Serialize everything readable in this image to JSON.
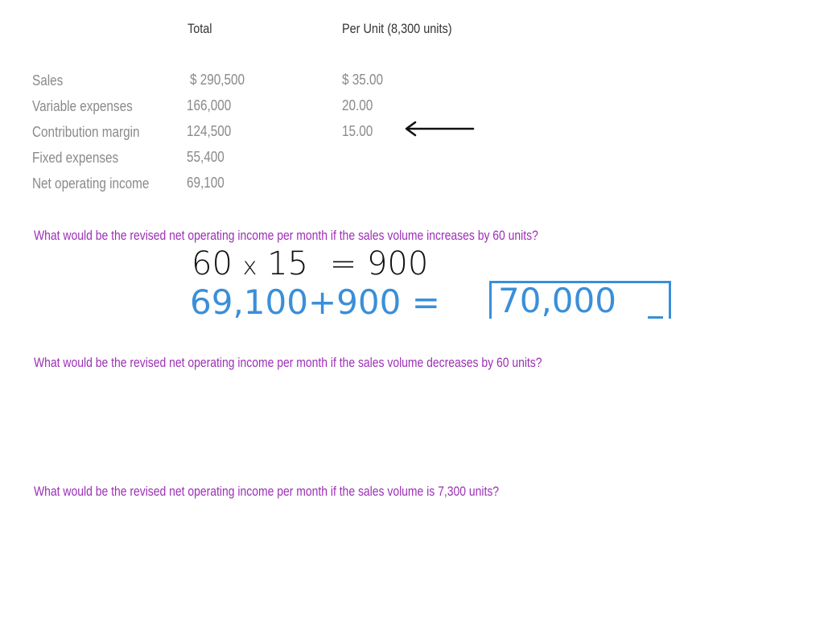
{
  "table": {
    "headers": [
      "Total",
      "Per Unit (8,300 units)"
    ],
    "rows": [
      {
        "label": "Sales",
        "total": "$ 290,500",
        "per_unit": "$ 35.00"
      },
      {
        "label": "Variable expenses",
        "total": "166,000",
        "per_unit": "20.00"
      },
      {
        "label": "Contribution margin",
        "total": "124,500",
        "per_unit": "15.00"
      },
      {
        "label": "Fixed expenses",
        "total": "55,400",
        "per_unit": ""
      },
      {
        "label": "Net operating income",
        "total": "69,100",
        "per_unit": ""
      }
    ]
  },
  "annotation_arrow": "left-arrow",
  "questions": [
    "What would be the revised net operating income per month if the sales volume increases by 60 units?",
    "What would be the revised net operating income per month if the sales volume decreases by 60 units?",
    "What would be the revised net operating income per month if the sales volume is 7,300 units?"
  ],
  "work": {
    "line1": {
      "a": "60",
      "op": "x",
      "b": "15",
      "eq": "=",
      "result": "900"
    },
    "line2": {
      "a": "69,100",
      "op": "+",
      "b": "900",
      "eq": "=",
      "result": "70,000"
    }
  }
}
